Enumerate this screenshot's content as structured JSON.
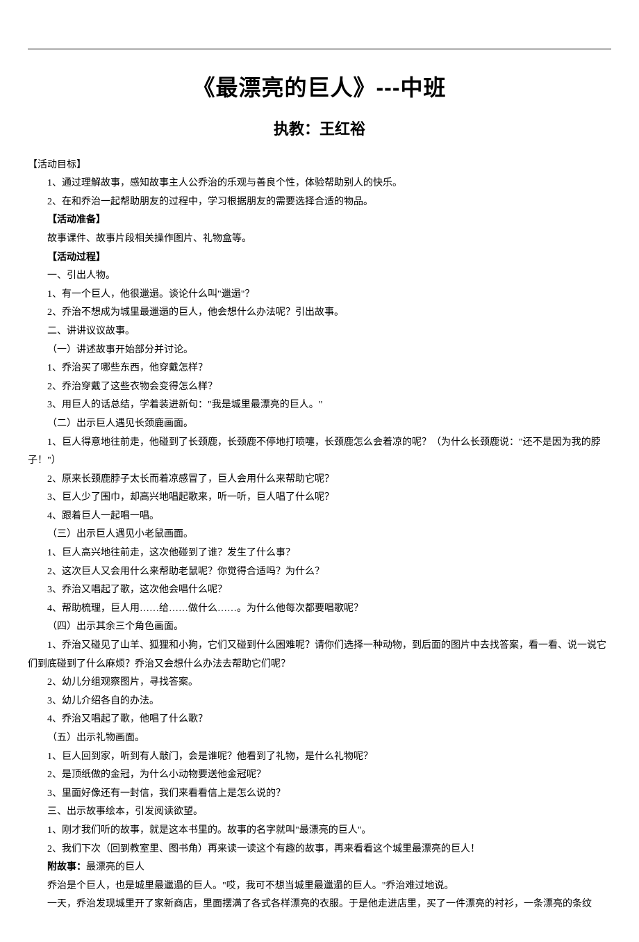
{
  "title": "《最漂亮的巨人》---中班",
  "subtitle": "执教：王红裕",
  "sections": {
    "goal_heading": "【活动目标】",
    "goal_1": "1、通过理解故事，感知故事主人公乔治的乐观与善良个性，体验帮助别人的快乐。",
    "goal_2": "2、在和乔治一起帮助朋友的过程中，学习根据朋友的需要选择合适的物品。",
    "prep_heading": "【活动准备】",
    "prep_1": "故事课件、故事片段相关操作图片、礼物盒等。",
    "process_heading": "【活动过程】",
    "p1": "一、引出人物。",
    "p2": "1、有一个巨人，他很邋遢。谈论什么叫\"邋遢\"？",
    "p3": "2、乔治不想成为城里最邋遢的巨人，他会想什么办法呢？引出故事。",
    "p4": "二、讲讲议议故事。",
    "p5": "（一）讲述故事开始部分并讨论。",
    "p6": "1、乔治买了哪些东西，他穿戴怎样？",
    "p7": "2、乔治穿戴了这些衣物会变得怎么样？",
    "p8": "3、用巨人的话总结，学着装进新句：\"我是城里最漂亮的巨人。\"",
    "p9": "（二）出示巨人遇见长颈鹿画面。",
    "p10": "1、巨人得意地往前走，他碰到了长颈鹿，长颈鹿不停地打喷嚏，长颈鹿怎么会着凉的呢？（为什么长颈鹿说：\"还不是因为我的脖子！\"）",
    "p11": "2、原来长颈鹿脖子太长而着凉感冒了，巨人会用什么来帮助它呢？",
    "p12": "3、巨人少了围巾，却高兴地唱起歌来，听一听，巨人唱了什么呢？",
    "p13": "4、跟着巨人一起唱一唱。",
    "p14": "（三）出示巨人遇见小老鼠画面。",
    "p15": "1、巨人高兴地往前走，这次他碰到了谁？发生了什么事？",
    "p16": "2、这次巨人又会用什么来帮助老鼠呢？你觉得合适吗？为什么？",
    "p17": "3、乔治又唱起了歌，这次他会唱什么呢？",
    "p18": "4、帮助梳理，巨人用……给……做什么……。为什么他每次都要唱歌呢？",
    "p19": "（四）出示其余三个角色画面。",
    "p20": "1、乔治又碰见了山羊、狐狸和小狗，它们又碰到什么困难呢？请你们选择一种动物，到后面的图片中去找答案，看一看、说一说它们到底碰到了什么麻烦？乔治又会想什么办法去帮助它们呢？",
    "p21": "2、幼儿分组观察图片，寻找答案。",
    "p22": "3、幼儿介绍各自的办法。",
    "p23": "4、乔治又唱起了歌，他唱了什么歌？",
    "p24": "（五）出示礼物画面。",
    "p25": "1、巨人回到家，听到有人敲门，会是谁呢？他看到了礼物，是什么礼物呢？",
    "p26": "2、是顶纸做的金冠，为什么小动物要送他金冠呢？",
    "p27": "3、里面好像还有一封信，我们来看看信上是怎么说的？",
    "p28": "三、出示故事绘本，引发阅读欲望。",
    "p29": "1、刚才我们听的故事，就是这本书里的。故事的名字就叫\"最漂亮的巨人\"。",
    "p30": "2、我们下次（回到教室里、图书角）再来读一读这个有趣的故事，再来看看这个城里最漂亮的巨人！",
    "story_label": "附故事：",
    "story_title": "最漂亮的巨人",
    "story_1": "乔治是个巨人，也是城里最邋遢的巨人。\"哎，我可不想当城里最邋遢的巨人。\"乔治难过地说。",
    "story_2": "一天，乔治发现城里开了家新商店，里面摆满了各式各样漂亮的衣服。于是他走进店里，买了一件漂亮的衬衫，一条漂亮的条纹"
  }
}
